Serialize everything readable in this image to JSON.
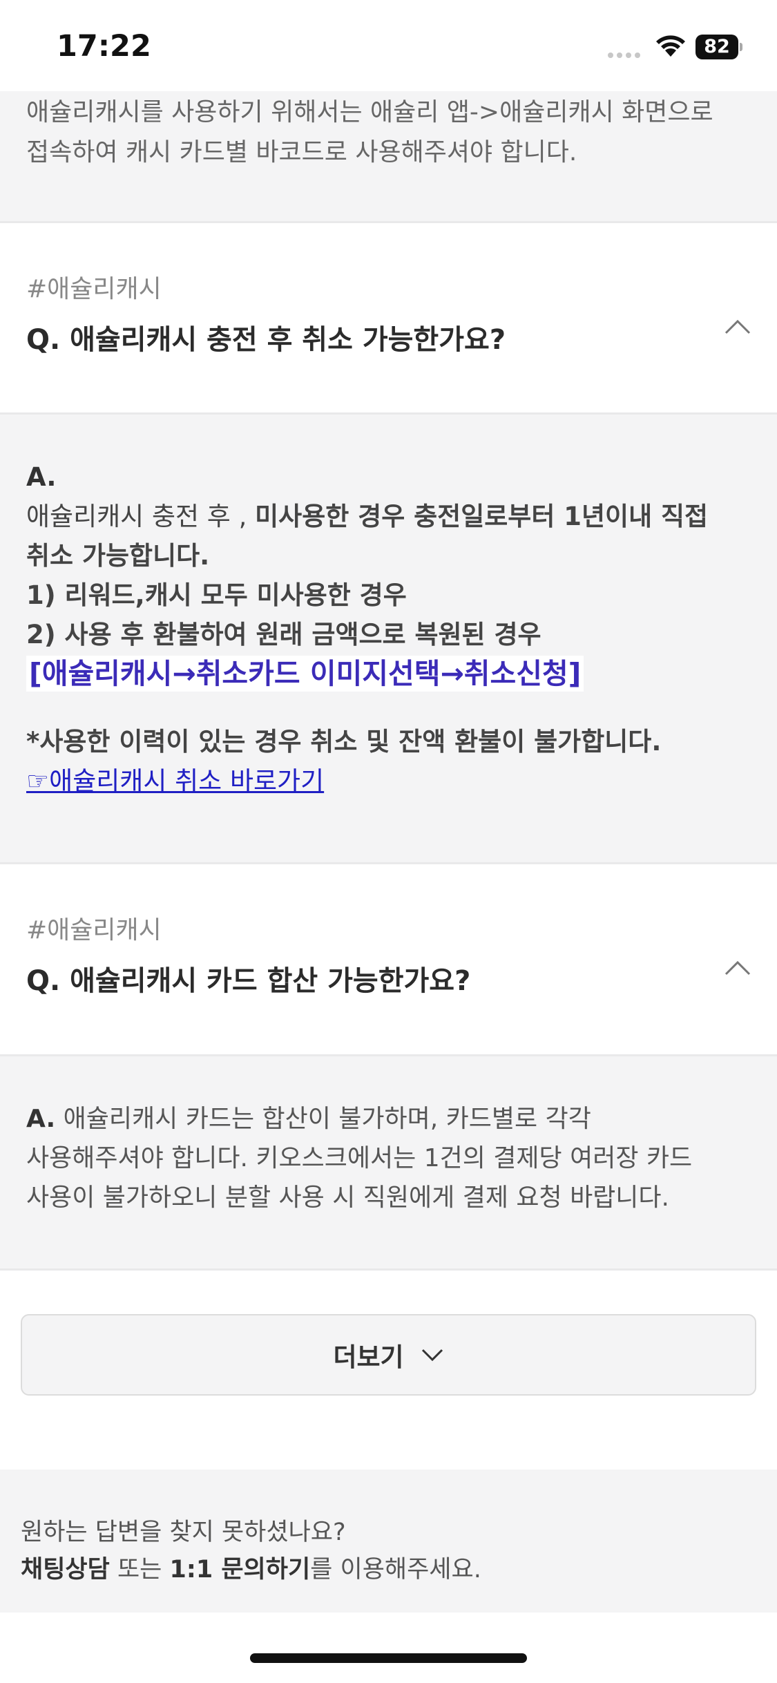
{
  "status_bar": {
    "time": "17:22",
    "battery": "82"
  },
  "prev_answer": {
    "text_line1": "애슐리캐시를 사용하기 위해서는 애슐리 앱->애슐리캐시 화면으로",
    "text_line2": "접속하여 캐시 카드별 바코드로 사용해주셔야 합니다."
  },
  "faq1": {
    "tag": "#애슐리캐시",
    "question": "Q. 애슐리캐시 충전 후 취소 가능한가요?",
    "answer_label": "A.",
    "line1_prefix": "애슐리캐시 충전 후 , ",
    "line1_bold": "미사용한 경우 충전일로부터 1년이내 직접",
    "line2": "취소 가능합니다.",
    "line3": "1) 리워드,캐시 모두 미사용한 경우",
    "line4": "2) 사용 후 환불하여 원래 금액으로 복원된 경우",
    "highlight": "[애슐리캐시→취소카드 이미지선택→취소신청]",
    "notice": "*사용한 이력이 있는 경우 취소 및 잔액 환불이 불가합니다.",
    "link": "☞애슐리캐시 취소 바로가기"
  },
  "faq2": {
    "tag": "#애슐리캐시",
    "question": "Q. 애슐리캐시 카드 합산 가능한가요?",
    "answer_label": "A.",
    "line1": " 애슐리캐시 카드는 합산이 불가하며, 카드별로 각각",
    "line2": "사용해주셔야 합니다. 키오스크에서는 1건의 결제당 여러장 카드",
    "line3": "사용이 불가하오니 분할 사용 시 직원에게 결제 요청 바랍니다."
  },
  "more_button": {
    "label": "더보기"
  },
  "footer": {
    "line1": "원하는 답변을 찾지 못하셨나요?",
    "chat": "채팅상담",
    "or": " 또는 ",
    "inquiry": "1:1 문의하기",
    "suffix": "를 이용해주세요."
  }
}
